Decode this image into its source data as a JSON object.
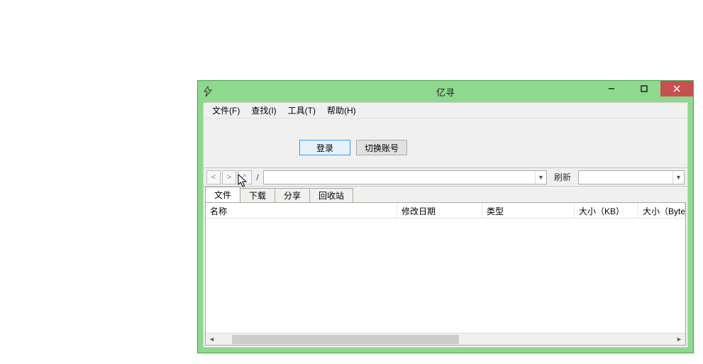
{
  "window": {
    "title": "亿寻"
  },
  "menu": {
    "file": "文件(F)",
    "find": "查找(I)",
    "tools": "工具(T)",
    "help": "帮助(H)"
  },
  "toolbar": {
    "login_label": "登录",
    "switch_account_label": "切换账号"
  },
  "nav": {
    "back": "<",
    "forward": ">",
    "up": "^",
    "path_sep": "/",
    "path_value": "",
    "refresh_label": "刷新",
    "filter_value": ""
  },
  "tabs": [
    {
      "label": "文件",
      "active": true
    },
    {
      "label": "下载",
      "active": false
    },
    {
      "label": "分享",
      "active": false
    },
    {
      "label": "回收站",
      "active": false
    }
  ],
  "columns": {
    "name": "名称",
    "modified": "修改日期",
    "type": "类型",
    "size_kb": "大小（KB）",
    "size_byte": "大小（Byte"
  }
}
